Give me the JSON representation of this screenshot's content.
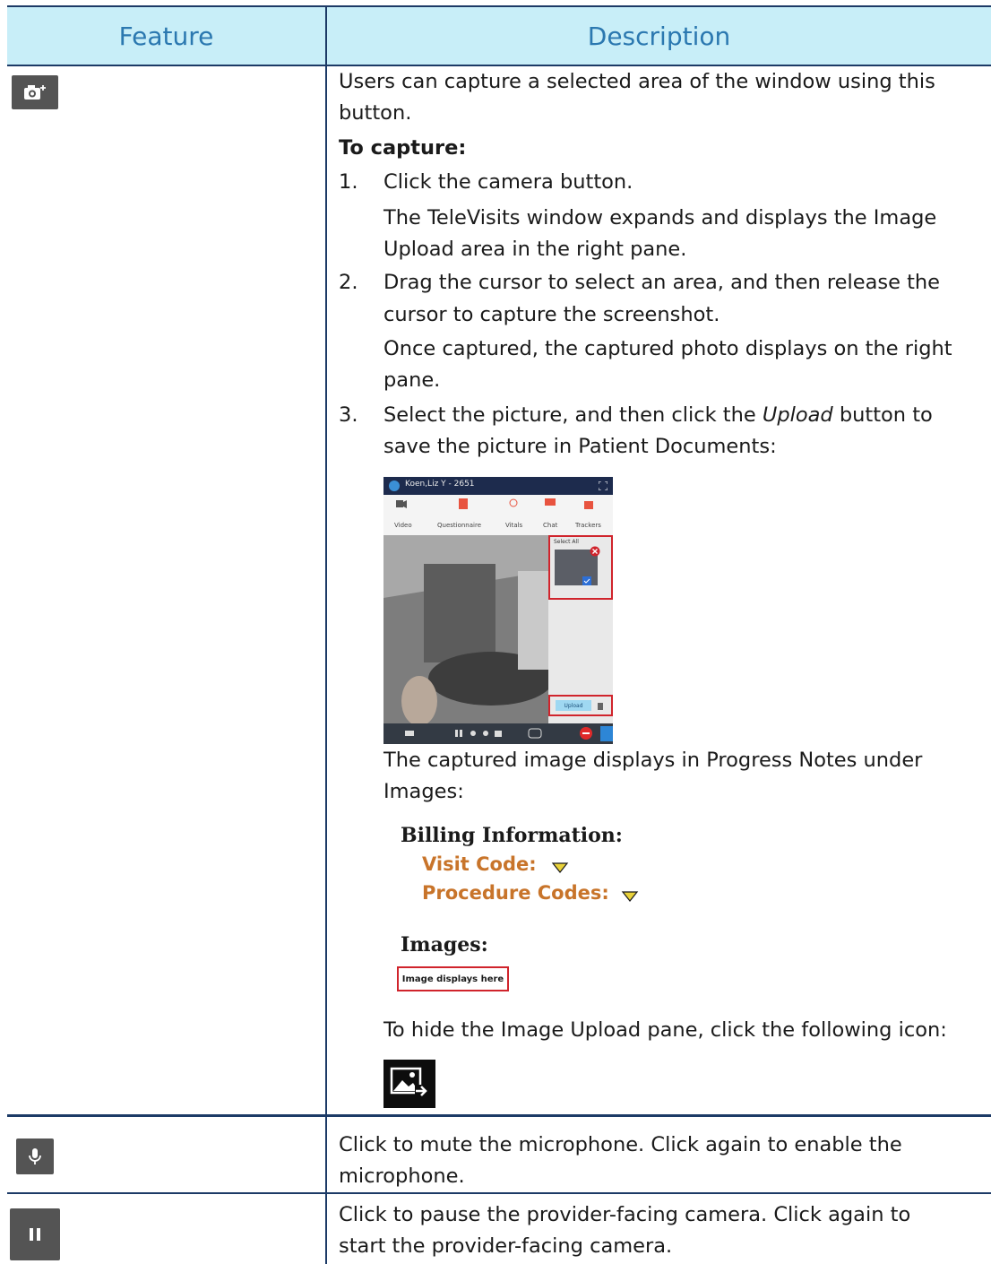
{
  "table": {
    "header": {
      "feature": "Feature",
      "description": "Description"
    }
  },
  "capture": {
    "icon": "camera-plus-icon",
    "intro_line1": "Users can capture a selected area of the window using this",
    "intro_line2": "button.",
    "heading": "To capture:",
    "steps": [
      {
        "num": "1.",
        "lines": [
          "Click the camera button."
        ],
        "note": [
          "The TeleVisits window expands and displays the Image",
          "Upload area in the right pane."
        ]
      },
      {
        "num": "2.",
        "lines": [
          "Drag the cursor to select an area, and then release the",
          "cursor to capture the screenshot."
        ],
        "note": [
          "Once captured, the captured photo displays on the right",
          "pane."
        ]
      },
      {
        "num": "3.",
        "line1_before": "Select the picture, and then click the ",
        "line1_italic": "Upload",
        "line1_after": " button to",
        "line2": "save the picture in Patient Documents:"
      }
    ],
    "screenshot": {
      "window_title": "Koen,Liz Y - 2651",
      "tabs": [
        "Video",
        "Questionnaire",
        "Vitals",
        "Chat",
        "Trackers"
      ],
      "select_all": "Select All",
      "upload": "Upload"
    },
    "after_screenshot": [
      "The captured image displays in Progress Notes under",
      "Images:"
    ],
    "billing": {
      "heading": "Billing Information:",
      "visit_code": "Visit Code:",
      "procedure_codes": "Procedure Codes:",
      "images_heading": "Images:",
      "image_placeholder": "Image displays here"
    },
    "hide_text": "To hide the Image Upload pane, click the following icon:",
    "hide_icon": "image-arrow-icon"
  },
  "mute": {
    "icon": "microphone-icon",
    "line1": "Click to mute the microphone. Click again to enable the",
    "line2": "microphone."
  },
  "pause": {
    "icon": "pause-icon",
    "line1": "Click to pause the provider-facing camera. Click again to",
    "line2": "start the provider-facing camera."
  }
}
